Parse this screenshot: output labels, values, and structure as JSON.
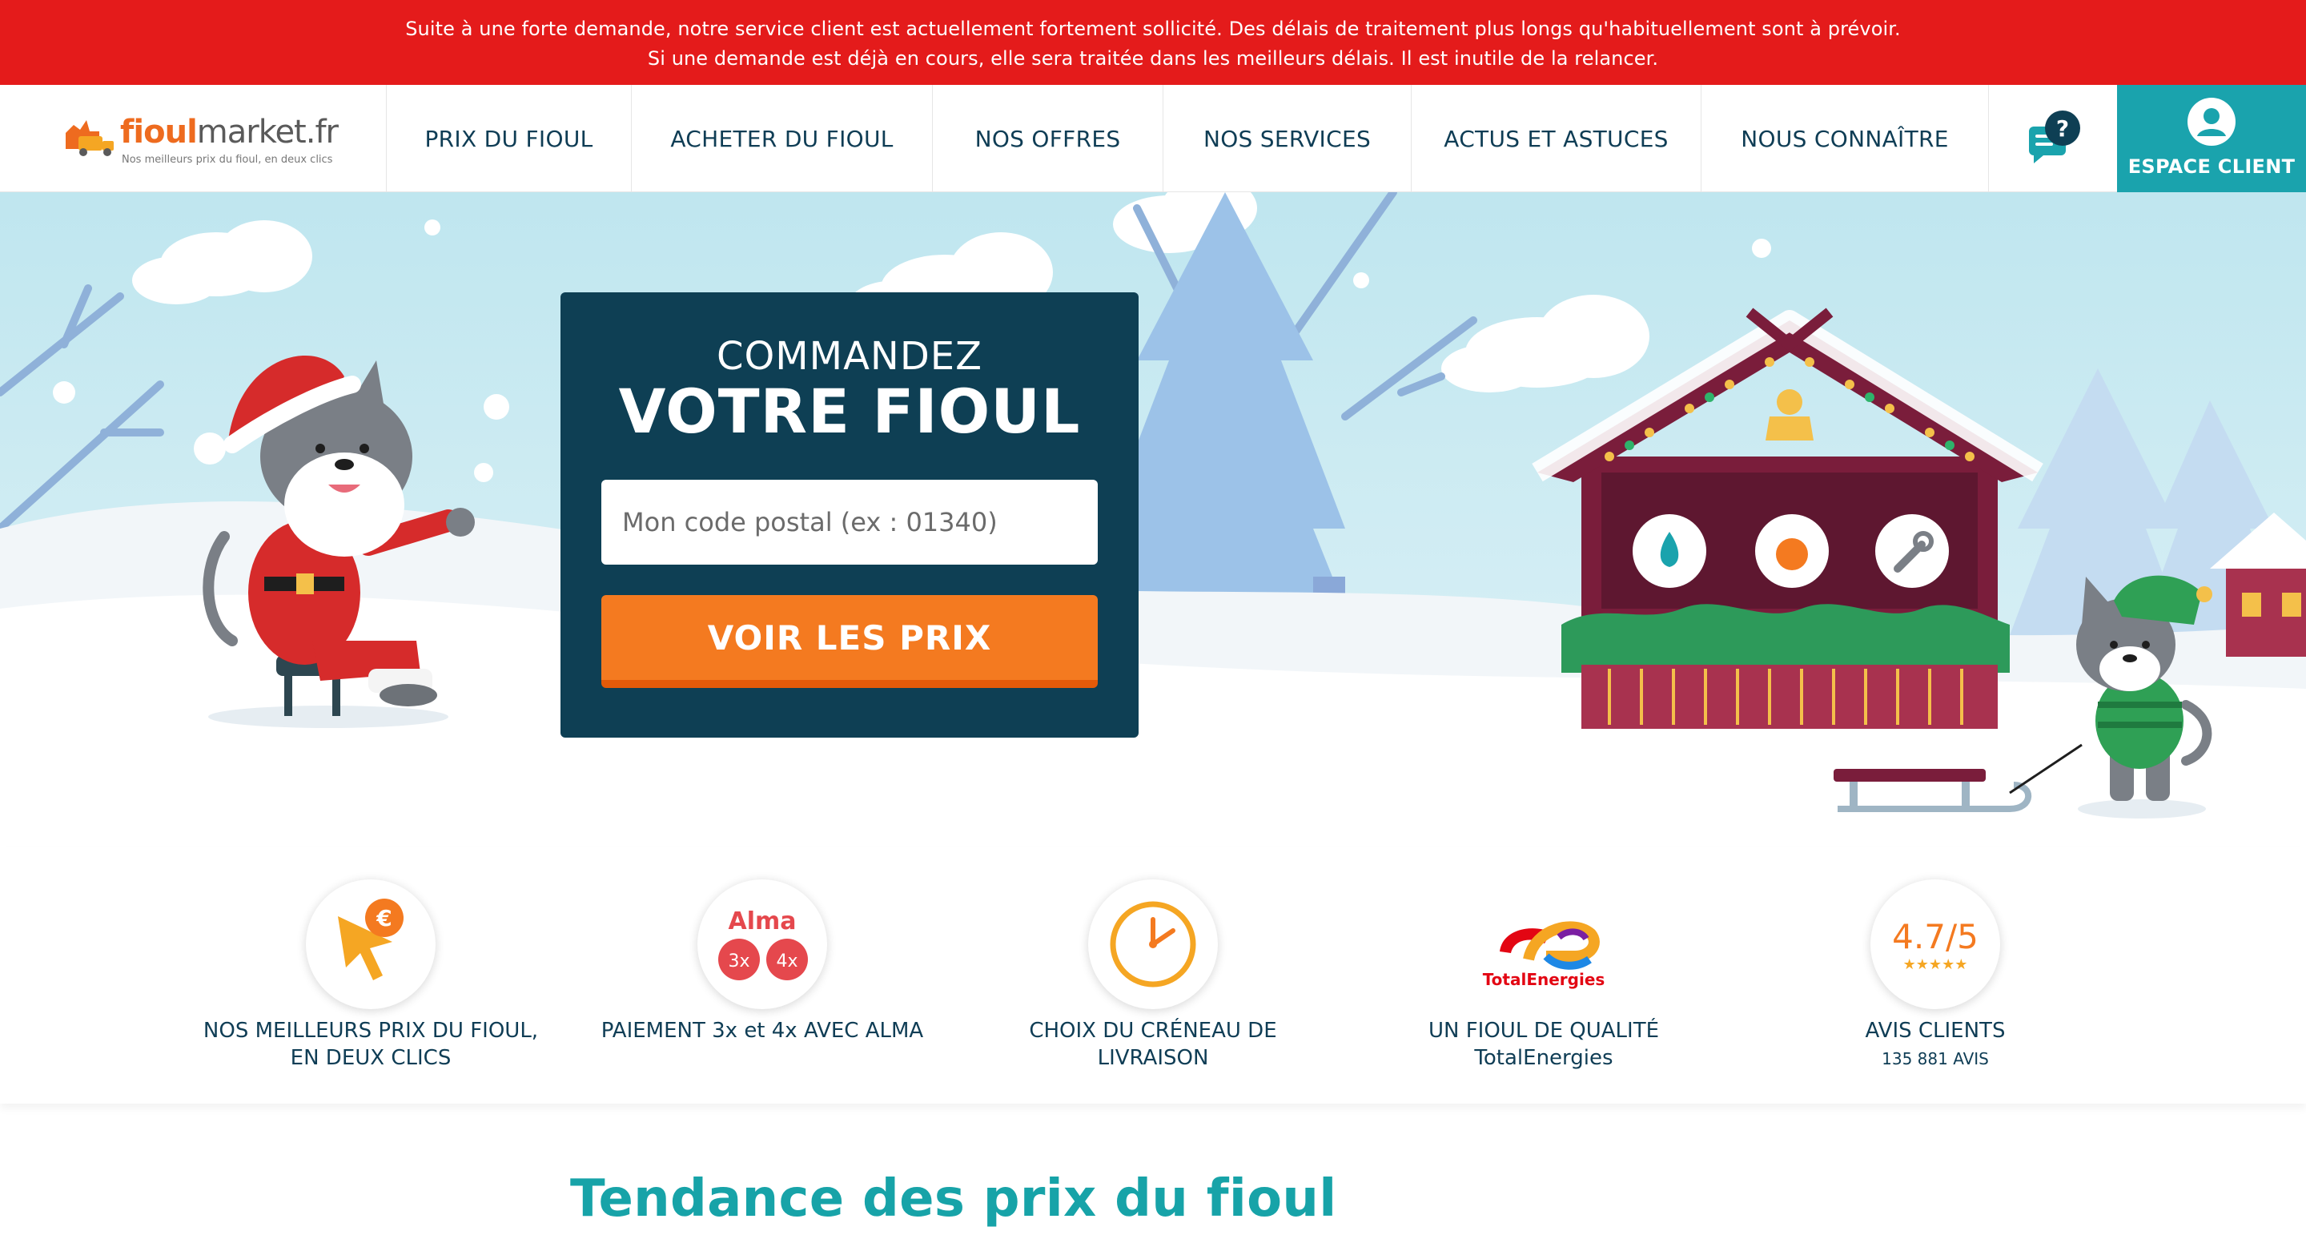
{
  "alert": {
    "line1": "Suite à une forte demande, notre service client est actuellement fortement sollicité. Des délais de traitement plus longs qu'habituellement sont à prévoir.",
    "line2": "Si une demande est déjà en cours, elle sera traitée dans les meilleurs délais. Il est inutile de la relancer."
  },
  "header": {
    "logo_bold": "fioul",
    "logo_rest": "market.fr",
    "logo_tagline": "Nos meilleurs prix du fioul, en deux clics",
    "nav": [
      "PRIX DU FIOUL",
      "ACHETER DU FIOUL",
      "NOS OFFRES",
      "NOS SERVICES",
      "ACTUS ET ASTUCES",
      "NOUS CONNAÎTRE"
    ],
    "help_icon": "chat-help-icon",
    "account_label": "ESPACE CLIENT",
    "account_icon": "user-icon"
  },
  "order": {
    "line1": "COMMANDEZ",
    "line2": "VOTRE FIOUL",
    "postal_placeholder": "Mon code postal (ex : 01340)",
    "button_label": "VOIR LES PRIX"
  },
  "features": [
    {
      "text": "NOS MEILLEURS PRIX DU FIOUL, EN DEUX CLICS",
      "icon": "cursor-euro-icon"
    },
    {
      "text": "PAIEMENT 3x et 4x AVEC ALMA",
      "icon": "alma-icon",
      "brand": "Alma",
      "badge1": "3x",
      "badge2": "4x"
    },
    {
      "text": "CHOIX DU CRÉNEAU DE LIVRAISON",
      "icon": "clock-icon"
    },
    {
      "text": "UN FIOUL DE QUALITÉ TotalEnergies",
      "icon": "totalenergies-logo",
      "brand": "TotalEnergies"
    },
    {
      "text": "AVIS CLIENTS",
      "icon": "rating-icon",
      "rating": "4.7/5",
      "stars": 4.7,
      "sub": "135 881 AVIS"
    }
  ],
  "trend_title": "Tendance des prix du fioul",
  "colors": {
    "alert": "#e41b1b",
    "navy": "#0e3f54",
    "teal": "#1aa3ad",
    "orange": "#f47a20"
  }
}
